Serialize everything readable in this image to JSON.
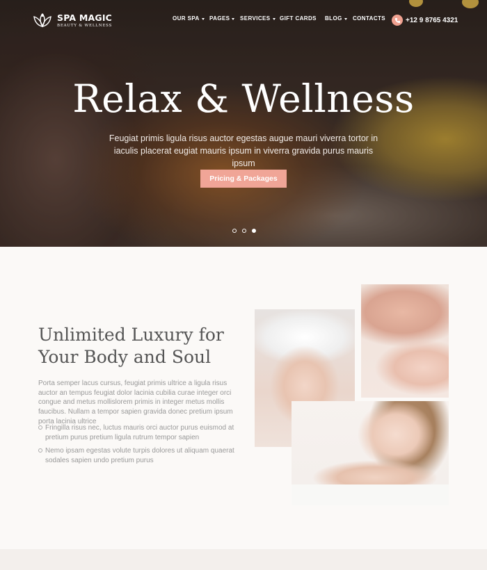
{
  "brand": {
    "name": "SPA MAGIC",
    "tagline": "BEAUTY & WELLNESS"
  },
  "nav": {
    "items": [
      {
        "label": "OUR SPA",
        "has_dropdown": true
      },
      {
        "label": "PAGES",
        "has_dropdown": true
      },
      {
        "label": "SERVICES",
        "has_dropdown": true
      },
      {
        "label": "GIFT CARDS",
        "has_dropdown": false
      },
      {
        "label": "BLOG",
        "has_dropdown": true
      },
      {
        "label": "CONTACTS",
        "has_dropdown": false
      }
    ],
    "phone": "+12 9 8765 4321"
  },
  "hero": {
    "title": "Relax & Wellness",
    "subtitle": "Feugiat primis ligula risus auctor egestas augue mauri viverra tortor in iaculis placerat eugiat mauris ipsum in viverra gravida purus mauris ipsum",
    "cta_label": "Pricing & Packages",
    "slides": {
      "count": 3,
      "active": 3
    }
  },
  "about": {
    "heading": "Unlimited Luxury for Your Body and Soul",
    "paragraph": "Porta semper lacus cursus, feugiat primis ultrice a ligula risus auctor an tempus feugiat dolor lacinia cubilia curae integer orci congue and metus mollislorem primis in integer metus mollis faucibus. Nullam a tempor sapien gravida donec pretium ipsum porta lacinia ultrice",
    "bullets": [
      "Fringilla risus nec, luctus mauris orci auctor purus euismod at pretium purus pretium ligula rutrum tempor sapien",
      "Nemo ipsam egestas volute turpis dolores ut aliquam quaerat sodales sapien undo pretium purus"
    ]
  },
  "colors": {
    "accent": "#f0a597",
    "heading": "#555555",
    "body_text": "#999999",
    "background": "#fbf9f7"
  }
}
